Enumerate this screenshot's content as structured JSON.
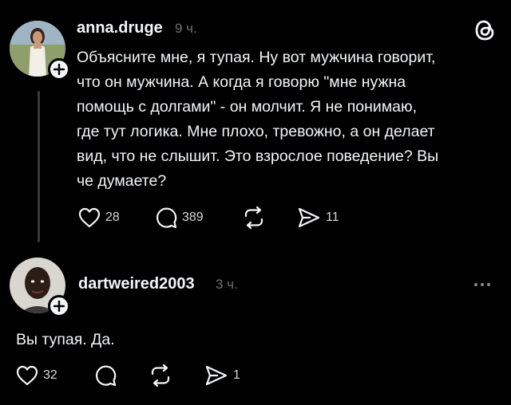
{
  "posts": [
    {
      "username": "anna.druge",
      "time": "9 ч.",
      "text_lines": [
        "Объясните мне, я тупая. Ну вот мужчина говорит,",
        "что он мужчина. А когда я говорю \"мне нужна",
        "помощь с долгами\" - он молчит. Я не понимаю,",
        "где тут логика. Мне плохо, тревожно, а он делает",
        "вид, что не слышит. Это взрослое поведение? Вы",
        "че думаете?"
      ],
      "likes": "28",
      "comments": "389",
      "reposts": "",
      "shares": "11"
    },
    {
      "username": "dartweired2003",
      "time": "3 ч.",
      "text_lines": [
        "Вы тупая. Да."
      ],
      "likes": "32",
      "comments": "",
      "reposts": "",
      "shares": "1"
    }
  ],
  "icons": {
    "app_logo": "threads-logo-icon",
    "like": "heart-icon",
    "comment": "comment-bubble-icon",
    "repost": "repost-icon",
    "share": "send-icon",
    "follow": "plus-icon",
    "menu": "more-horizontal-icon"
  },
  "colors": {
    "background": "#000000",
    "text": "#f3f5f7",
    "muted": "#6f6f6f",
    "thread_line": "#3a3a3a"
  }
}
